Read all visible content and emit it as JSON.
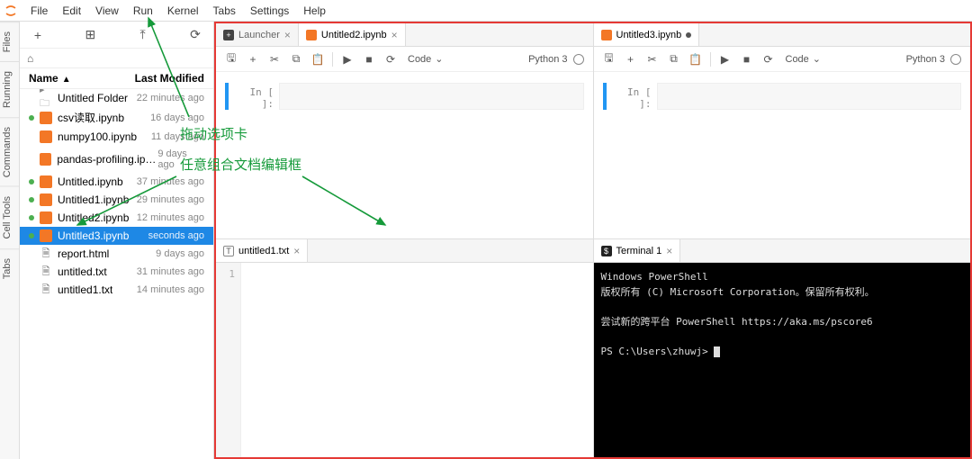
{
  "menu": {
    "items": [
      "File",
      "Edit",
      "View",
      "Run",
      "Kernel",
      "Tabs",
      "Settings",
      "Help"
    ]
  },
  "vtabs": [
    "Files",
    "Running",
    "Commands",
    "Cell Tools",
    "Tabs"
  ],
  "sidebar": {
    "toolbar_icons": {
      "new": "+",
      "new_folder": "⊞",
      "upload": "⤒",
      "refresh": "⟳"
    },
    "breadcrumb_icon": "⌂",
    "name_header": "Name",
    "mod_header": "Last Modified",
    "files": [
      {
        "type": "folder",
        "dot": false,
        "name": "Untitled Folder",
        "mod": "22 minutes ago",
        "sel": false
      },
      {
        "type": "nb",
        "dot": true,
        "name": "csv读取.ipynb",
        "mod": "16 days ago",
        "sel": false
      },
      {
        "type": "nb",
        "dot": false,
        "name": "numpy100.ipynb",
        "mod": "11 days ago",
        "sel": false
      },
      {
        "type": "nb",
        "dot": false,
        "name": "pandas-profiling.ipynb",
        "mod": "9 days ago",
        "sel": false
      },
      {
        "type": "nb",
        "dot": true,
        "name": "Untitled.ipynb",
        "mod": "37 minutes ago",
        "sel": false
      },
      {
        "type": "nb",
        "dot": true,
        "name": "Untitled1.ipynb",
        "mod": "29 minutes ago",
        "sel": false
      },
      {
        "type": "nb",
        "dot": true,
        "name": "Untitled2.ipynb",
        "mod": "12 minutes ago",
        "sel": false
      },
      {
        "type": "nb",
        "dot": true,
        "name": "Untitled3.ipynb",
        "mod": "seconds ago",
        "sel": true
      },
      {
        "type": "file",
        "dot": false,
        "name": "report.html",
        "mod": "9 days ago",
        "sel": false
      },
      {
        "type": "file",
        "dot": false,
        "name": "untitled.txt",
        "mod": "31 minutes ago",
        "sel": false
      },
      {
        "type": "file",
        "dot": false,
        "name": "untitled1.txt",
        "mod": "14 minutes ago",
        "sel": false
      }
    ]
  },
  "panes": {
    "tl": {
      "tabs": [
        {
          "type": "launcher",
          "label": "Launcher",
          "close": true,
          "active": false,
          "dirty": false
        },
        {
          "type": "nb",
          "label": "Untitled2.ipynb",
          "close": true,
          "active": true,
          "dirty": true
        }
      ],
      "toolbar": {
        "celltype": "Code",
        "kernel": "Python 3"
      },
      "cell_prompt": "In [ ]:"
    },
    "tr": {
      "tabs": [
        {
          "type": "nb",
          "label": "Untitled3.ipynb",
          "close": false,
          "active": true,
          "dirty": true
        }
      ],
      "toolbar": {
        "celltype": "Code",
        "kernel": "Python 3"
      },
      "cell_prompt": "In [ ]:"
    },
    "bl": {
      "tabs": [
        {
          "type": "txt",
          "label": "untitled1.txt",
          "close": true,
          "active": true,
          "dirty": false
        }
      ],
      "line1": "1"
    },
    "br": {
      "tabs": [
        {
          "type": "term",
          "label": "Terminal 1",
          "close": true,
          "active": true,
          "dirty": false
        }
      ],
      "lines": [
        "Windows PowerShell",
        "版权所有 (C) Microsoft Corporation。保留所有权利。",
        "",
        "尝试新的跨平台 PowerShell https://aka.ms/pscore6",
        "",
        "PS C:\\Users\\zhuwj> "
      ]
    }
  },
  "annotations": {
    "a1": "拖动选项卡",
    "a2": "任意组合文档编辑框"
  },
  "tb_icons": {
    "save": "🖫",
    "add": "+",
    "cut": "✂",
    "copy": "⧉",
    "paste": "📋",
    "run": "▶",
    "stop": "■",
    "restart": "⟳",
    "chev": "⌄"
  }
}
